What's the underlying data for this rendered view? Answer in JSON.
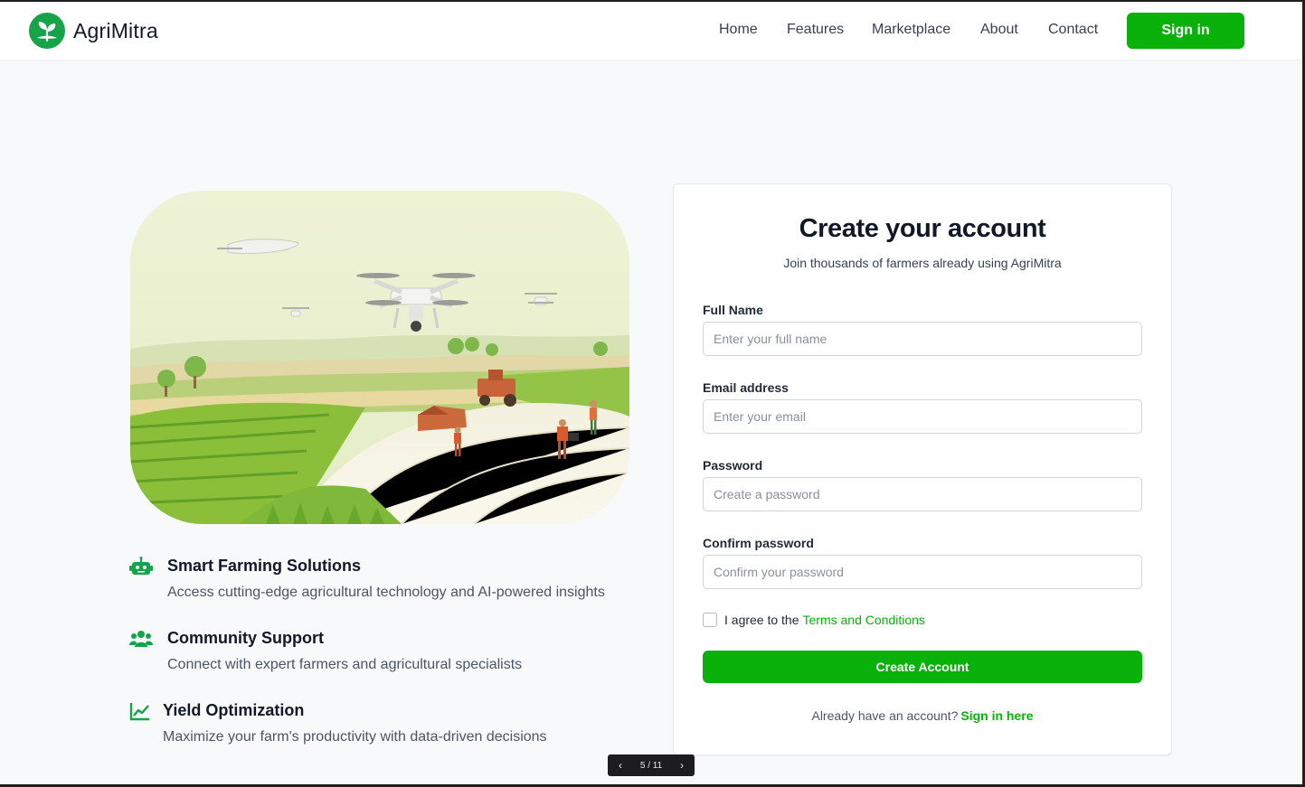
{
  "nav": {
    "brand": "AgriMitra",
    "links": [
      "Home",
      "Features",
      "Marketplace",
      "About",
      "Contact"
    ],
    "signin_label": "Sign in",
    "accent": "#0bb10b"
  },
  "features": [
    {
      "icon": "robot-icon",
      "title": "Smart Farming Solutions",
      "desc": "Access cutting-edge agricultural technology and AI-powered insights"
    },
    {
      "icon": "users-icon",
      "title": "Community Support",
      "desc": "Connect with expert farmers and agricultural specialists"
    },
    {
      "icon": "chart-line-icon",
      "title": "Yield Optimization",
      "desc": "Maximize your farm's productivity with data-driven decisions"
    }
  ],
  "form": {
    "title": "Create your account",
    "subtitle": "Join thousands of farmers already using AgriMitra",
    "fields": [
      {
        "label": "Full Name",
        "placeholder": "Enter your full name",
        "value": ""
      },
      {
        "label": "Email address",
        "placeholder": "Enter your email",
        "value": ""
      },
      {
        "label": "Password",
        "placeholder": "Create a password",
        "value": ""
      },
      {
        "label": "Confirm password",
        "placeholder": "Confirm your password",
        "value": ""
      }
    ],
    "terms_prefix": "I agree to the",
    "terms_link": "Terms and Conditions",
    "terms_checked": false,
    "submit_label": "Create Account",
    "already_text": "Already have an account?",
    "signin_link": "Sign in here"
  },
  "pager": {
    "label": "5 / 11",
    "prev_icon": "chevron-left-icon",
    "next_icon": "chevron-right-icon"
  }
}
